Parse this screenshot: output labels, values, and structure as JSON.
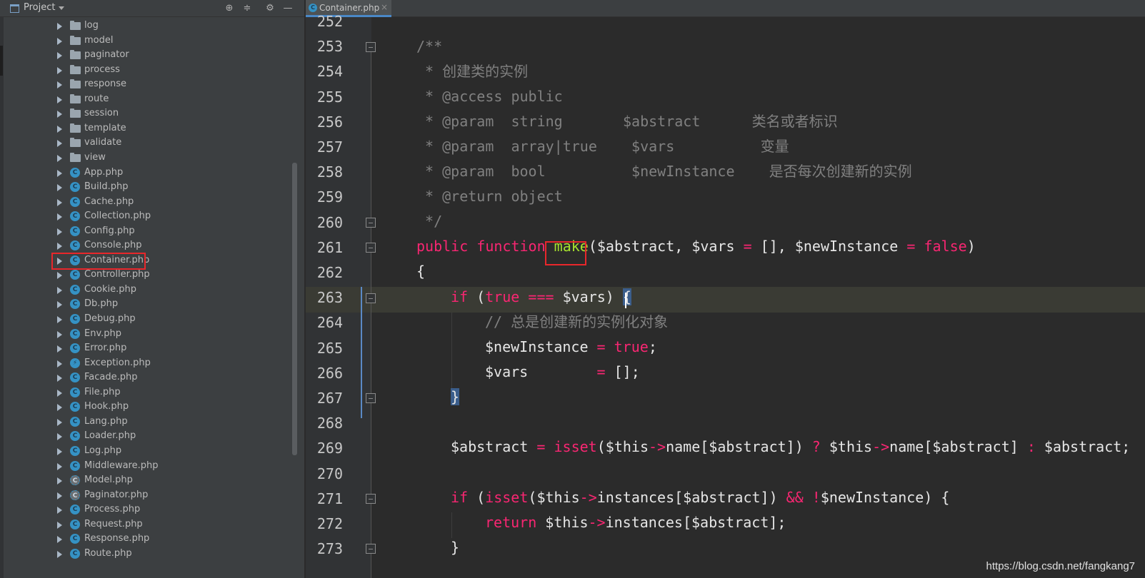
{
  "project": {
    "title": "Project",
    "folders": [
      "log",
      "model",
      "paginator",
      "process",
      "response",
      "route",
      "session",
      "template",
      "validate",
      "view"
    ],
    "files": [
      {
        "name": "App.php",
        "kind": "class"
      },
      {
        "name": "Build.php",
        "kind": "class"
      },
      {
        "name": "Cache.php",
        "kind": "class"
      },
      {
        "name": "Collection.php",
        "kind": "class"
      },
      {
        "name": "Config.php",
        "kind": "class"
      },
      {
        "name": "Console.php",
        "kind": "class"
      },
      {
        "name": "Container.php",
        "kind": "class"
      },
      {
        "name": "Controller.php",
        "kind": "class"
      },
      {
        "name": "Cookie.php",
        "kind": "class"
      },
      {
        "name": "Db.php",
        "kind": "class"
      },
      {
        "name": "Debug.php",
        "kind": "class"
      },
      {
        "name": "Env.php",
        "kind": "class"
      },
      {
        "name": "Error.php",
        "kind": "class"
      },
      {
        "name": "Exception.php",
        "kind": "exception"
      },
      {
        "name": "Facade.php",
        "kind": "class"
      },
      {
        "name": "File.php",
        "kind": "class"
      },
      {
        "name": "Hook.php",
        "kind": "class"
      },
      {
        "name": "Lang.php",
        "kind": "class"
      },
      {
        "name": "Loader.php",
        "kind": "class"
      },
      {
        "name": "Log.php",
        "kind": "class"
      },
      {
        "name": "Middleware.php",
        "kind": "class"
      },
      {
        "name": "Model.php",
        "kind": "abstract"
      },
      {
        "name": "Paginator.php",
        "kind": "abstract"
      },
      {
        "name": "Process.php",
        "kind": "class"
      },
      {
        "name": "Request.php",
        "kind": "class"
      },
      {
        "name": "Response.php",
        "kind": "class"
      },
      {
        "name": "Route.php",
        "kind": "class"
      }
    ],
    "selected_file": "Container.php"
  },
  "editor": {
    "tab_label": "Container.php",
    "tab_close": "×",
    "tab_icon": "C",
    "lines": [
      {
        "n": "252"
      },
      {
        "n": "253"
      },
      {
        "n": "254"
      },
      {
        "n": "255"
      },
      {
        "n": "256"
      },
      {
        "n": "257"
      },
      {
        "n": "258"
      },
      {
        "n": "259"
      },
      {
        "n": "260"
      },
      {
        "n": "261"
      },
      {
        "n": "262"
      },
      {
        "n": "263"
      },
      {
        "n": "264"
      },
      {
        "n": "265"
      },
      {
        "n": "266"
      },
      {
        "n": "267"
      },
      {
        "n": "268"
      },
      {
        "n": "269"
      },
      {
        "n": "270"
      },
      {
        "n": "271"
      },
      {
        "n": "272"
      },
      {
        "n": "273"
      }
    ],
    "code": {
      "l253": "/**",
      "l254": " * 创建类的实例",
      "l255": " * @access public",
      "l256_a": " * @param  string       $abstract      ",
      "l256_b": "类名或者标识",
      "l257_a": " * @param  array|true    $vars          ",
      "l257_b": "变量",
      "l258_a": " * @param  bool          $newInstance    ",
      "l258_b": "是否每次创建新的实例",
      "l259": " * @return object",
      "l260": " */",
      "l261_kw1": "public",
      "l261_kw2": "function",
      "l261_fn": "make",
      "l261_p1": "($abstract, $vars ",
      "l261_eq1": "=",
      "l261_p2": " [], $newInstance ",
      "l261_eq2": "=",
      "l261_false": "false",
      "l261_close": ")",
      "l262": "{",
      "l263_if": "if",
      "l263_p": " (",
      "l263_true": "true",
      "l263_op": "===",
      "l263_vars": " $vars) ",
      "l263_brace": "{",
      "l264": "// 总是创建新的实例化对象",
      "l265_var": "$newInstance ",
      "l265_eq": "=",
      "l265_true": "true",
      "l265_end": ";",
      "l266_var": "$vars        ",
      "l266_eq": "=",
      "l266_end": " [];",
      "l267": "}",
      "l269_a": "$abstract ",
      "l269_eq": "=",
      "l269_isset": "isset",
      "l269_b": "($this",
      "l269_arrow1": "->",
      "l269_c": "name[$abstract]) ",
      "l269_q": "?",
      "l269_d": " $this",
      "l269_arrow2": "->",
      "l269_e": "name[$abstract] ",
      "l269_colon": ":",
      "l269_f": " $abstract;",
      "l271_if": "if",
      "l271_a": " (",
      "l271_isset": "isset",
      "l271_b": "($this",
      "l271_arrow": "->",
      "l271_c": "instances[$abstract]) ",
      "l271_and": "&&",
      "l271_not": "!",
      "l271_d": "$newInstance) {",
      "l272_ret": "return",
      "l272_a": " $this",
      "l272_arrow": "->",
      "l272_b": "instances[$abstract];",
      "l273": "}"
    }
  },
  "watermark": "https://blog.csdn.net/fangkang7"
}
